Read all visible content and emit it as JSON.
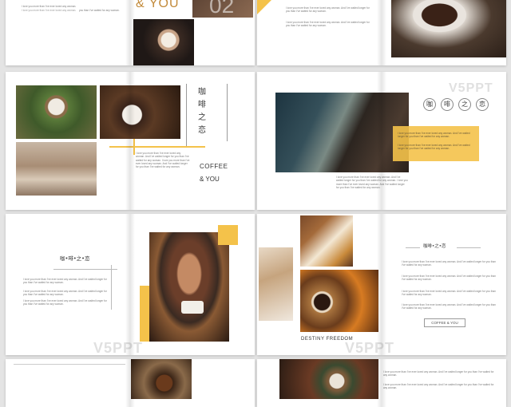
{
  "filler_line": "I love you more than I've ever loved any woman. And I've waited longer for you than I've waited for any woman.",
  "filler_short": "I love you more than I've ever loved any woman.",
  "filler_tail": "you than I've waited for any woman.",
  "filler_long": "I love you more than I've ever loved any woman. And I've waited longer for you than I've waited for any woman. I love you more than I've ever loved any woman. And I've waited longer for you than I've waited for any woman.",
  "spread1": {
    "title_fragment": "& YOU",
    "number_fragment": "02"
  },
  "spread3": {
    "vertical_title": "咖啡之恋",
    "coffee_label": "COFFEE",
    "and_you_label": "& YOU"
  },
  "spread4": {
    "circle_chars": [
      "咖",
      "啡",
      "之",
      "恋"
    ]
  },
  "spread5": {
    "title": "咖•啡•之•恋"
  },
  "spread7": {
    "caption": "DESTINY  FREEDOM"
  },
  "spread8": {
    "title": "咖啡•之•恋",
    "button_label": "COFFEE & YOU"
  },
  "watermark": {
    "text": "V5PPT"
  },
  "colors": {
    "accent": "#f4c24a",
    "page": "#ffffff",
    "background": "#e4e4e4"
  }
}
